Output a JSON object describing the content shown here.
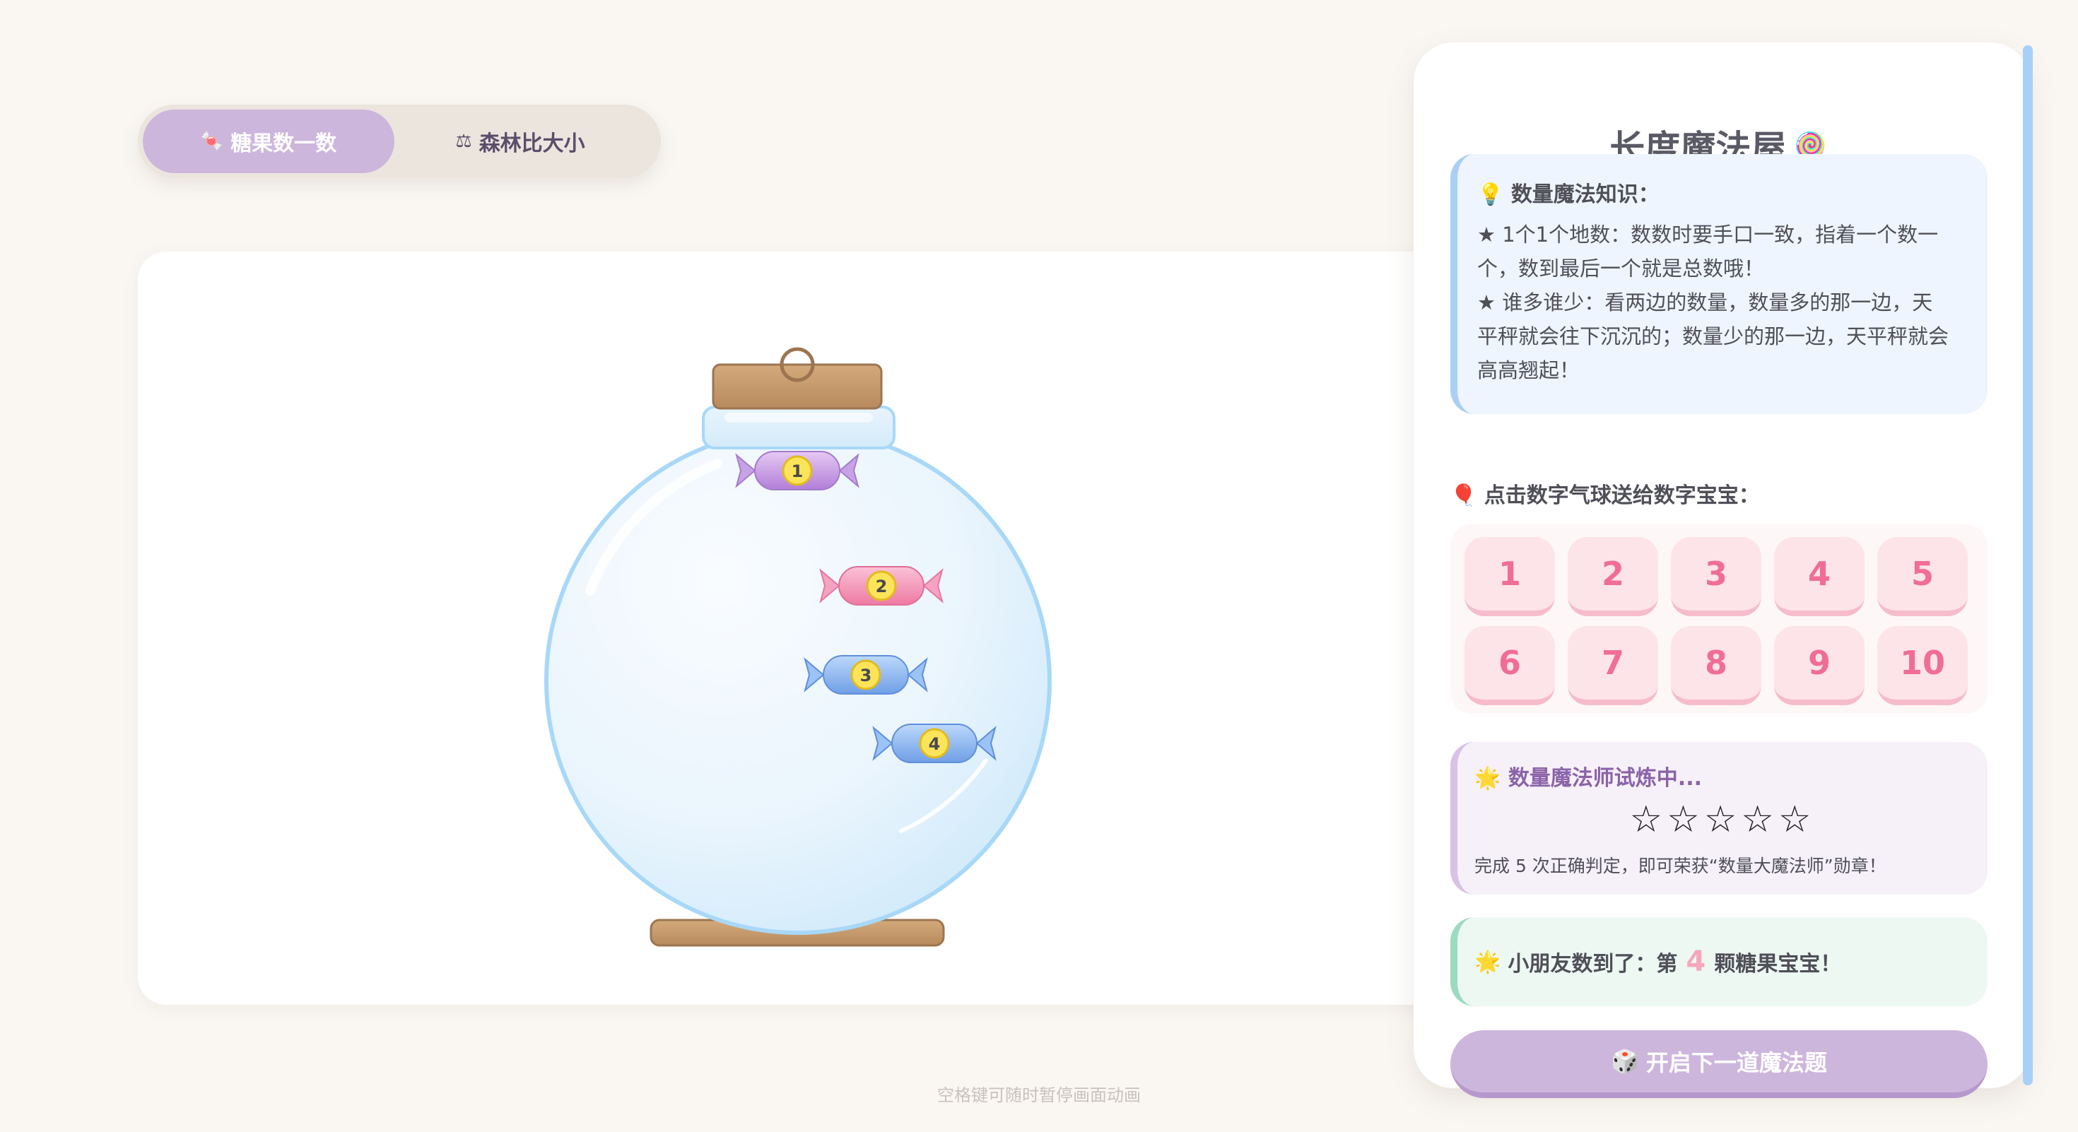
{
  "tabs": [
    {
      "icon": "🍬",
      "label": "糖果数一数",
      "active": true
    },
    {
      "icon": "⚖",
      "label": "森林比大小",
      "active": false
    }
  ],
  "jar": {
    "candies": [
      {
        "number": "1",
        "color": "purple"
      },
      {
        "number": "2",
        "color": "pink"
      },
      {
        "number": "3",
        "color": "blue"
      },
      {
        "number": "4",
        "color": "blue"
      }
    ]
  },
  "panel": {
    "title": "长度魔法屋",
    "title_icon": "🍭",
    "knowledge": {
      "icon": "💡",
      "heading": "数量魔法知识：",
      "lines": [
        "★ 1个1个地数：数数时要手口一致，指着一个数一",
        "个，数到最后一个就是总数哦！",
        "★ 谁多谁少：看两边的数量，数量多的那一边，天",
        "平秤就会往下沉沉的；数量少的那一边，天平秤就会",
        "高高翘起！"
      ]
    },
    "balloon_prompt": {
      "icon": "🎈",
      "text": "点击数字气球送给数字宝宝："
    },
    "numbers": [
      "1",
      "2",
      "3",
      "4",
      "5",
      "6",
      "7",
      "8",
      "9",
      "10"
    ],
    "trial": {
      "icon": "🌟",
      "heading": "数量魔法师试炼中...",
      "stars": "☆☆☆☆☆",
      "stars_filled": 0,
      "stars_total": 5,
      "note": "完成 5 次正确判定，即可荣获“数量大魔法师”勋章！"
    },
    "progress": {
      "icon": "🌟",
      "prefix": "小朋友数到了：第",
      "count": "4",
      "suffix": "颗糖果宝宝！"
    },
    "next_button": {
      "icon": "🎲",
      "label": "开启下一道魔法题"
    }
  },
  "footer_hint": "空格键可随时暂停画面动画",
  "colors": {
    "accent_purple": "#cdb6dc",
    "number_pink": "#f06d95",
    "jar_blue": "#a8d8f8",
    "wood": "#c49a6c",
    "scrollbar": "#a7d0f7"
  }
}
